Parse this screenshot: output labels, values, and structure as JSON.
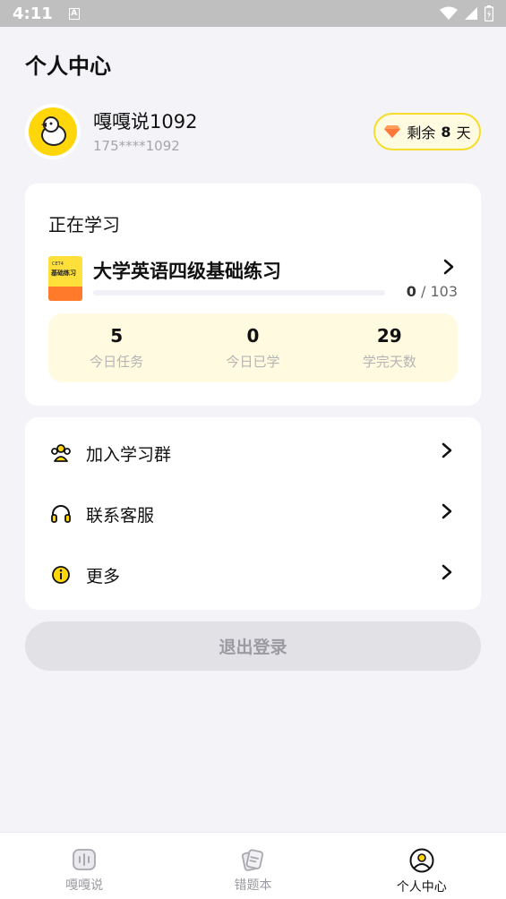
{
  "status_bar": {
    "time": "4:11",
    "notification_icon": "A"
  },
  "page": {
    "title": "个人中心"
  },
  "profile": {
    "username": "嘎嘎说1092",
    "phone": "175****1092",
    "vip": {
      "prefix": "剩余",
      "days": "8",
      "suffix": "天",
      "icon": "diamond-icon"
    }
  },
  "study": {
    "section_title": "正在学习",
    "course": {
      "cover_small": "CET4",
      "cover_title": "基础练习",
      "name": "大学英语四级基础练习",
      "progress_current": "0",
      "progress_separator": "/",
      "progress_total": "103",
      "progress_fraction": 0
    },
    "stats": [
      {
        "value": "5",
        "label": "今日任务"
      },
      {
        "value": "0",
        "label": "今日已学"
      },
      {
        "value": "29",
        "label": "学完天数"
      }
    ]
  },
  "menu": [
    {
      "label": "加入学习群",
      "icon": "group-icon"
    },
    {
      "label": "联系客服",
      "icon": "headset-icon"
    },
    {
      "label": "更多",
      "icon": "info-icon"
    }
  ],
  "logout_label": "退出登录",
  "tabs": [
    {
      "label": "嘎嘎说",
      "icon": "audio-wave-icon",
      "active": false
    },
    {
      "label": "错题本",
      "icon": "notebook-icon",
      "active": false
    },
    {
      "label": "个人中心",
      "icon": "profile-icon",
      "active": true
    }
  ],
  "colors": {
    "accent": "#ffcc00",
    "background": "#f4f4f8",
    "stats_bg": "#fffae0"
  }
}
